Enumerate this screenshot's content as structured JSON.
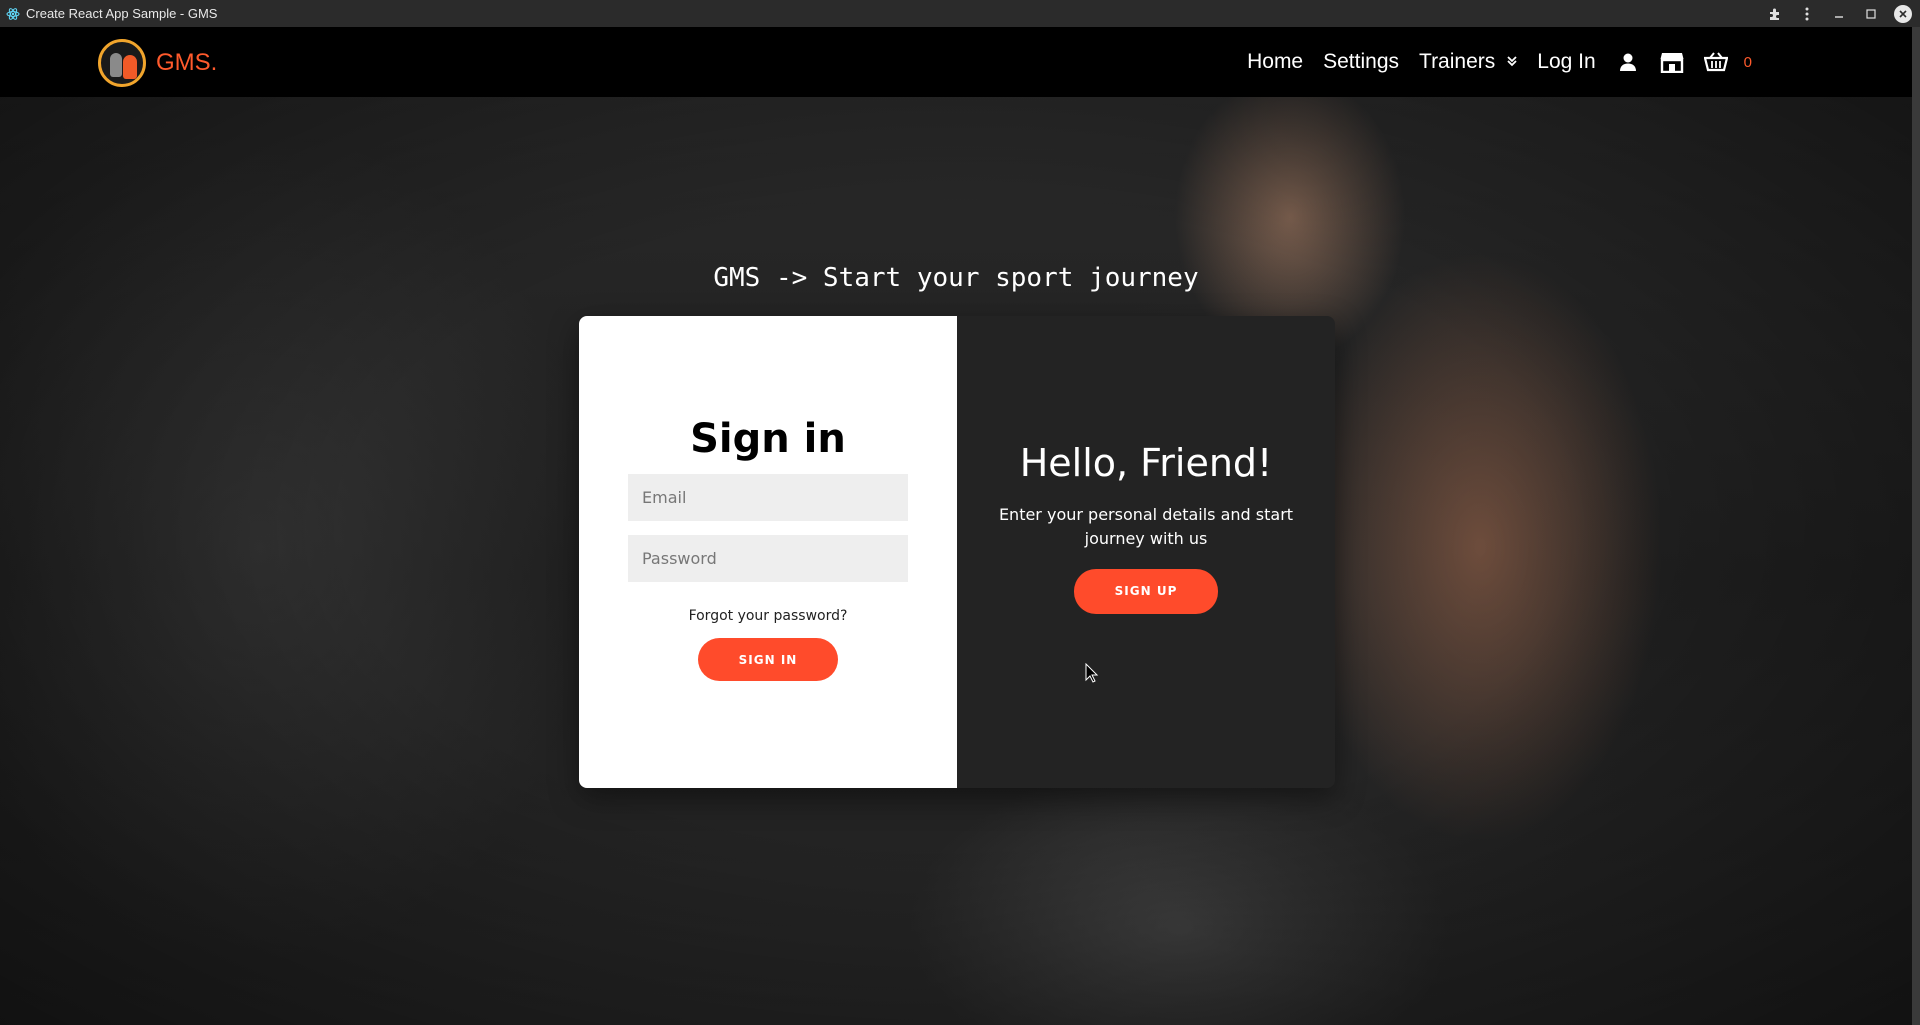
{
  "window": {
    "title": "Create React App Sample - GMS"
  },
  "navbar": {
    "brand": "GMS.",
    "links": {
      "home": "Home",
      "settings": "Settings",
      "trainers": "Trainers",
      "login": "Log In"
    },
    "icons": [
      "user-icon",
      "store-icon",
      "cart-icon"
    ],
    "cart_count": "0",
    "accent_color": "#ff5a2c"
  },
  "hero": {
    "tagline": "GMS -> Start your sport journey"
  },
  "signin": {
    "title": "Sign in",
    "email_placeholder": "Email",
    "password_placeholder": "Password",
    "forgot": "Forgot your password?",
    "button": "SIGN IN"
  },
  "overlay": {
    "title": "Hello, Friend!",
    "text": "Enter your personal details and start journey with us",
    "button": "SIGN UP"
  }
}
